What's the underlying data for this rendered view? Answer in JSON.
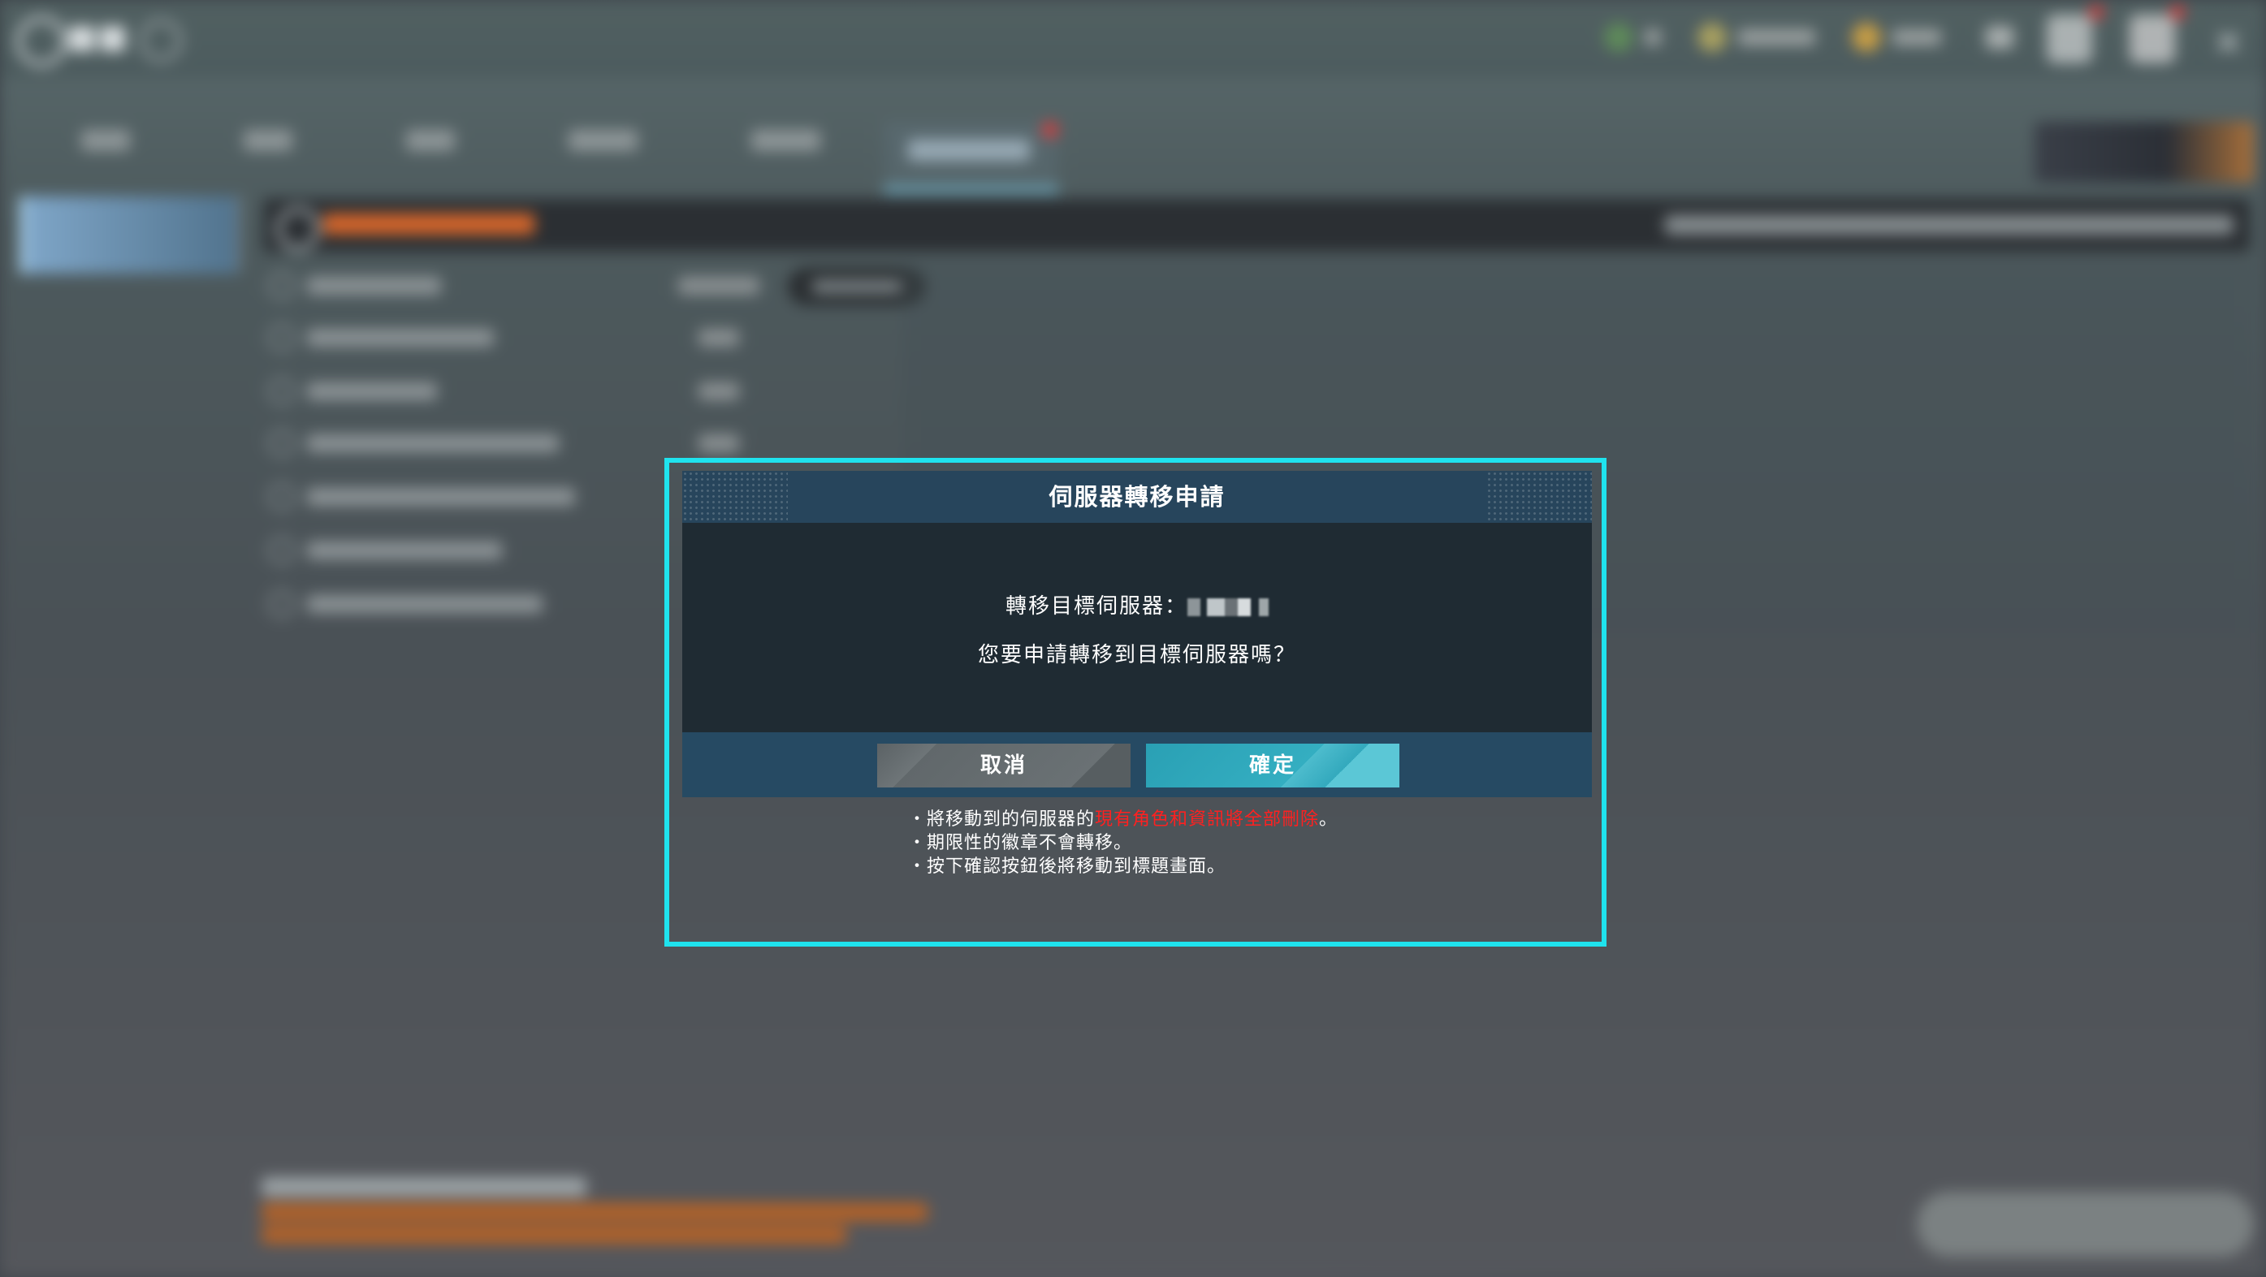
{
  "dialog": {
    "title": "伺服器轉移申請",
    "target_label": "轉移目標伺服器：",
    "question": "您要申請轉移到目標伺服器嗎？",
    "cancel_label": "取消",
    "confirm_label": "確定"
  },
  "notes": [
    {
      "prefix": "・將移動到的伺服器的",
      "warning": "現有角色和資訊將全部刪除",
      "suffix": "。"
    },
    {
      "text": "・期限性的徽章不會轉移。"
    },
    {
      "text": "・按下確認按鈕後將移動到標題畫面。"
    }
  ],
  "colors": {
    "highlight": "#1fe3ee",
    "header": "#27455c",
    "confirm": "#2aa0b4",
    "cancel": "#61686b",
    "warning": "#ff2020"
  }
}
